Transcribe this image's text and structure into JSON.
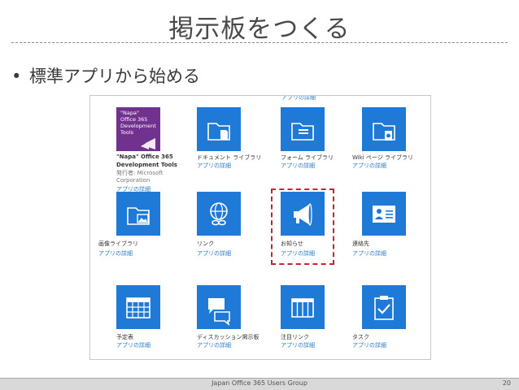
{
  "slide": {
    "title": "掲示板をつくる",
    "bullet": "標準アプリから始める",
    "footer": "Japan Office 365 Users Group",
    "page_number": "20"
  },
  "screenshot": {
    "top_link": "アプリの詳細",
    "napa": {
      "tile_text": "\"Napa\"\nOffice 365\nDevelopment\nTools",
      "name_line1": "\"Napa\" Office 365",
      "name_line2": "Development Tools",
      "publisher_line1": "発行者: Microsoft",
      "publisher_line2": "Corporation",
      "link": "アプリの詳細"
    },
    "apps": [
      {
        "name": "ドキュメント ライブラリ",
        "link": "アプリの詳細",
        "icon": "folder-doc-icon"
      },
      {
        "name": "フォーム ライブラリ",
        "link": "アプリの詳細",
        "icon": "folder-form-icon"
      },
      {
        "name": "Wiki ページ ライブラリ",
        "link": "アプリの詳細",
        "icon": "folder-wiki-icon"
      },
      {
        "name": "画像ライブラリ",
        "link": "アプリの詳細",
        "icon": "folder-image-icon"
      },
      {
        "name": "リンク",
        "link": "アプリの詳細",
        "icon": "globe-link-icon"
      },
      {
        "name": "お知らせ",
        "link": "アプリの詳細",
        "icon": "megaphone-icon"
      },
      {
        "name": "連絡先",
        "link": "アプリの詳細",
        "icon": "contact-card-icon"
      },
      {
        "name": "予定表",
        "link": "アプリの詳細",
        "icon": "calendar-icon"
      },
      {
        "name": "ディスカッション掲示板",
        "link": "アプリの詳細",
        "icon": "discussion-icon"
      },
      {
        "name": "注目リンク",
        "link": "アプリの詳細",
        "icon": "promoted-links-icon"
      },
      {
        "name": "タスク",
        "link": "アプリの詳細",
        "icon": "task-clipboard-icon"
      }
    ]
  },
  "colors": {
    "tile_blue": "#1e7ad6",
    "napa_purple": "#70318f",
    "link_blue": "#2a7ac4",
    "highlight_red": "#c0282d"
  }
}
